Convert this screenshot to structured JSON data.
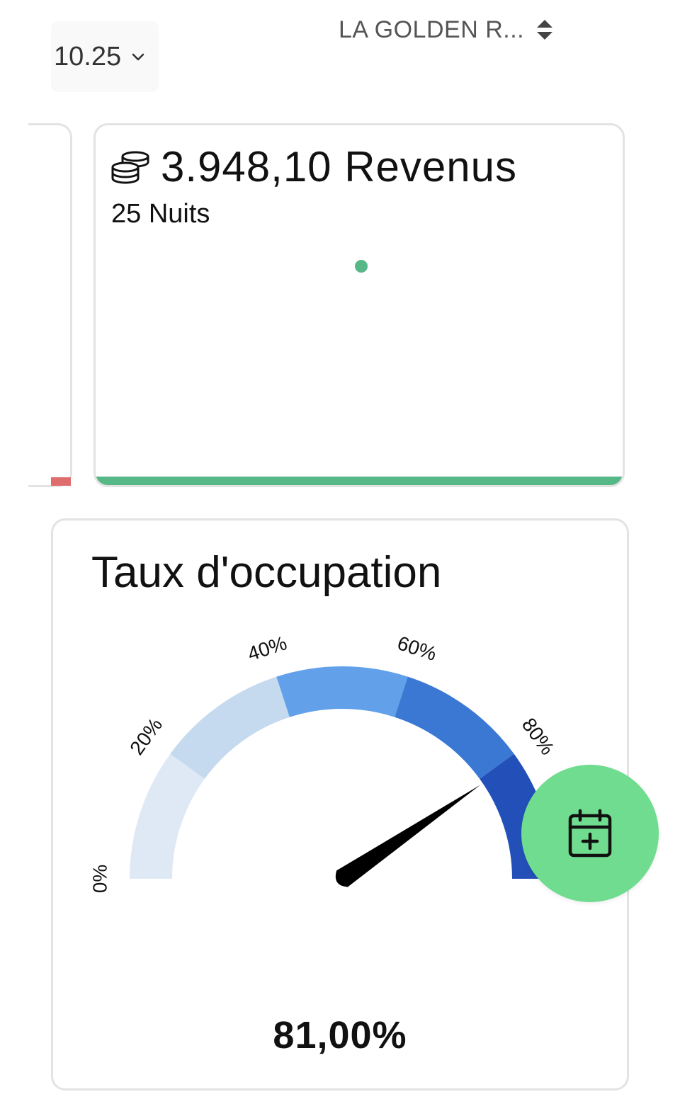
{
  "header": {
    "month": "10.25",
    "property": "LA GOLDEN R..."
  },
  "revenue": {
    "icon": "coins-icon",
    "title": "3.948,10 Revenus",
    "nights": "25 Nuits",
    "accent_color": "#57b887"
  },
  "occupancy": {
    "title": "Taux d'occupation",
    "value_label": "81,00%",
    "value": 81,
    "ticks": [
      "0%",
      "20%",
      "40%",
      "60%",
      "80%"
    ],
    "bands": [
      {
        "from": 0,
        "to": 20,
        "color": "#dfe9f6"
      },
      {
        "from": 20,
        "to": 40,
        "color": "#c5d9ef"
      },
      {
        "from": 40,
        "to": 60,
        "color": "#62a0ea"
      },
      {
        "from": 60,
        "to": 80,
        "color": "#3a78d4"
      },
      {
        "from": 80,
        "to": 100,
        "color": "#2350b8"
      }
    ]
  },
  "fab": {
    "icon": "calendar-plus-icon",
    "color": "#6fdc8f"
  }
}
